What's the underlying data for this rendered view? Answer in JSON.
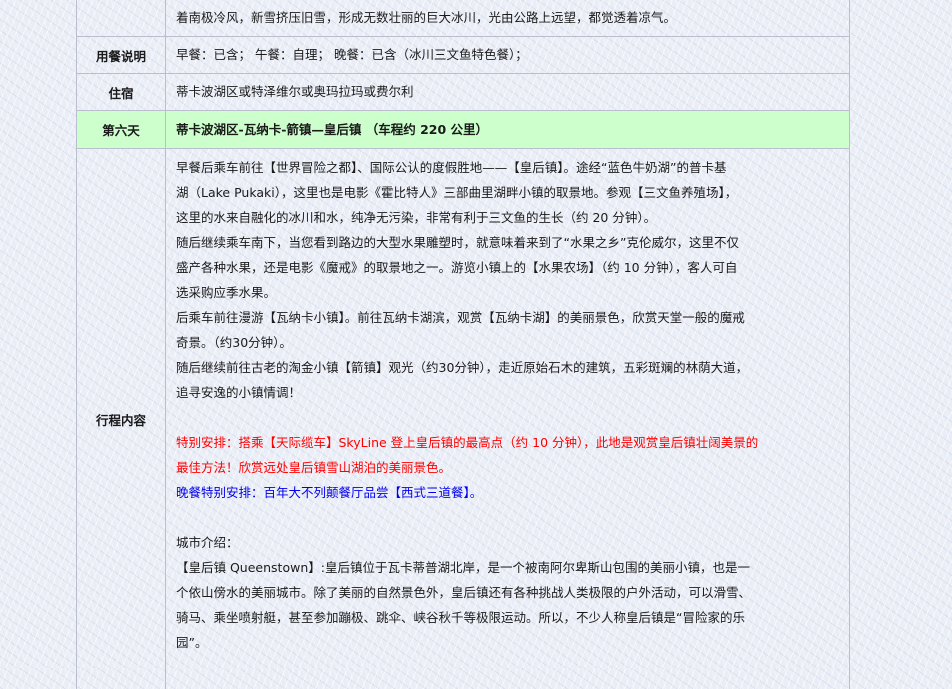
{
  "intro_text": "着南极冷风，新雪挤压旧雪，形成无数壮丽的巨大冰川，光由公路上远望，都觉透着凉气。",
  "meals": {
    "label": "用餐说明",
    "value": "早餐：已含；   午餐：自理；  晚餐：已含（冰川三文鱼特色餐）；"
  },
  "lodging": {
    "label": "住宿",
    "value": "蒂卡波湖区或特泽维尔或奥玛拉玛或费尔利"
  },
  "day": {
    "label": "第六天",
    "title": "蒂卡波湖区-瓦纳卡-箭镇—皇后镇      （车程约 220 公里）"
  },
  "itinerary": {
    "label": "行程内容",
    "para1_l1": "早餐后乘车前往【世界冒险之都】、国际公认的度假胜地——【皇后镇】。途经“蓝色牛奶湖”的普卡基",
    "para1_l2": "湖（Lake Pukaki），这里也是电影《霍比特人》三部曲里湖畔小镇的取景地。参观【三文鱼养殖场】，",
    "para1_l3": "这里的水来自融化的冰川和水，纯净无污染，非常有利于三文鱼的生长（约 20 分钟）。",
    "para2_l1": "随后继续乘车南下，当您看到路边的大型水果雕塑时，就意味着来到了“水果之乡”克伦威尔，这里不仅",
    "para2_l2": "盛产各种水果，还是电影《魔戒》的取景地之一。游览小镇上的【水果农场】（约 10 分钟），客人可自",
    "para2_l3": "选采购应季水果。",
    "para3_l1": "后乘车前往漫游【瓦纳卡小镇】。前往瓦纳卡湖滨，观赏【瓦纳卡湖】的美丽景色，欣赏天堂一般的魔戒",
    "para3_l2": "奇景。（约30分钟）。",
    "para4_l1": "随后继续前往古老的淘金小镇【箭镇】观光（约30分钟），走近原始石木的建筑，五彩斑斓的林荫大道，",
    "para4_l2": "追寻安逸的小镇情调！",
    "special_l1": "特别安排：搭乘【天际缆车】SkyLine 登上皇后镇的最高点（约 10 分钟），此地是观赏皇后镇壮阔美景的",
    "special_l2": "最佳方法！欣赏远处皇后镇雪山湖泊的美丽景色。",
    "dinner": "晚餐特别安排：百年大不列颠餐厅品尝【西式三道餐】。",
    "city_intro_label": "城市介绍：",
    "city_l1": "【皇后镇 Queenstown】:皇后镇位于瓦卡蒂普湖北岸，是一个被南阿尔卑斯山包围的美丽小镇，也是一",
    "city_l2": "个依山傍水的美丽城市。除了美丽的自然景色外，皇后镇还有各种挑战人类极限的户外活动，可以滑雪、",
    "city_l3": "骑马、乘坐喷射艇，甚至参加蹦极、跳伞、峡谷秋千等极限运动。所以，不少人称皇后镇是“冒险家的乐",
    "city_l4": "园”。"
  },
  "colors": {
    "day_row_bg": "#ccffcc",
    "special_text": "#ff0000",
    "dinner_text": "#0000ee"
  }
}
